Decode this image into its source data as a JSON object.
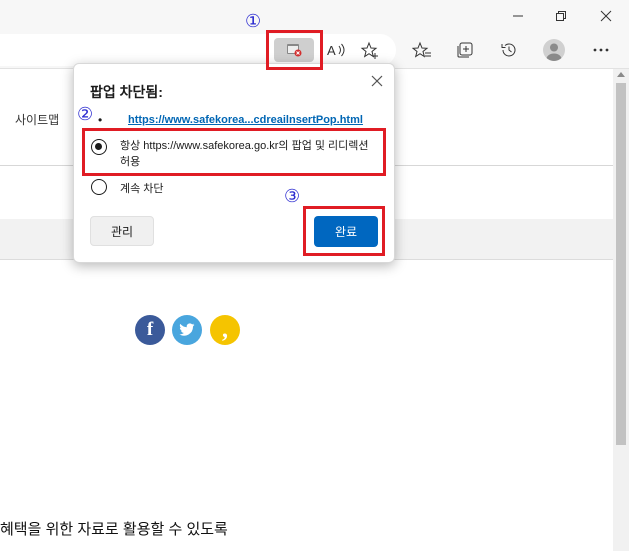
{
  "browser": {
    "window_controls": {
      "minimize_icon": "minimize-icon",
      "maximize_icon": "restore-icon",
      "close_icon": "close-icon"
    },
    "toolbar": {
      "icons": [
        "popup-blocked-icon",
        "read-aloud-icon",
        "add-favorite-icon",
        "favorites-icon",
        "collections-icon",
        "history-icon",
        "profile-icon",
        "more-icon"
      ]
    }
  },
  "page": {
    "sitemap": "사이트맵",
    "bottom_text": "혜택을 위한 자료로 활용할 수 있도록",
    "social": {
      "facebook": "f",
      "kakaostory": ","
    }
  },
  "dialog": {
    "title": "팝업 차단됨:",
    "bullet": "•",
    "blocked_link": "https://www.safekorea...cdreailnsertPop.html",
    "option_allow": "항상 https://www.safekorea.go.kr의 팝업 및 리디렉션 허용",
    "option_block": "계속 차단",
    "manage_button": "관리",
    "done_button": "완료"
  },
  "annotations": {
    "step1": "①",
    "step2": "②",
    "step3": "③"
  },
  "colors": {
    "callout_red": "#e01c24",
    "step_blue": "#2a2ad0",
    "primary_button": "#0067c0",
    "link": "#0066b4"
  }
}
